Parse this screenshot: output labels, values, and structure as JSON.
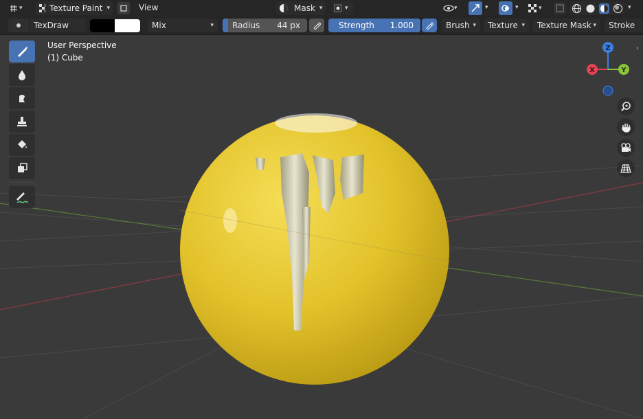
{
  "header": {
    "mode_label": "Texture Paint",
    "view_menu": "View",
    "mask_label": "Mask"
  },
  "toolbar": {
    "brush_name": "TexDraw",
    "blend_mode": "Mix",
    "radius_label": "Radius",
    "radius_value": "44 px",
    "strength_label": "Strength",
    "strength_value": "1.000",
    "menus": [
      "Brush",
      "Texture",
      "Texture Mask",
      "Stroke"
    ]
  },
  "viewport": {
    "perspective_label": "User Perspective",
    "object_label": "(1) Cube"
  },
  "gizmo": {
    "z": "Z",
    "x": "X",
    "y": "Y"
  },
  "colors": {
    "accent": "#4772b3",
    "sphere": "#e0c22a",
    "axis_x": "#e04556",
    "axis_y": "#8bc43a",
    "axis_z": "#3d7fe0"
  },
  "icons": {
    "tools": [
      "draw-brush-icon",
      "soften-icon",
      "smear-icon",
      "clone-stamp-icon",
      "fill-bucket-icon",
      "mask-icon",
      "annotate-icon"
    ],
    "nav": [
      "zoom-icon",
      "pan-hand-icon",
      "camera-icon",
      "grid-ortho-icon"
    ]
  }
}
